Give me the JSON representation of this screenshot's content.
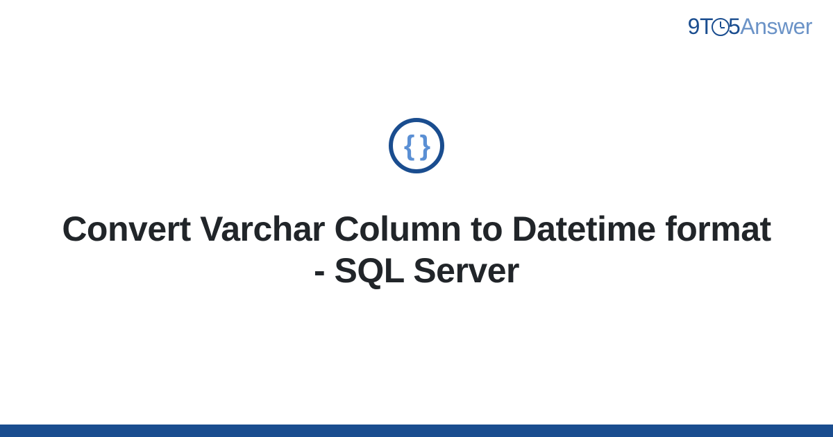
{
  "brand": {
    "part1": "9T",
    "part2": "5",
    "part3": "Answer"
  },
  "icon": {
    "symbol": "{ }"
  },
  "title": "Convert Varchar Column to Datetime format - SQL Server",
  "colors": {
    "primary": "#1a4d8f",
    "secondary": "#6b93c7",
    "braces": "#5a8fd4",
    "text": "#212529"
  }
}
